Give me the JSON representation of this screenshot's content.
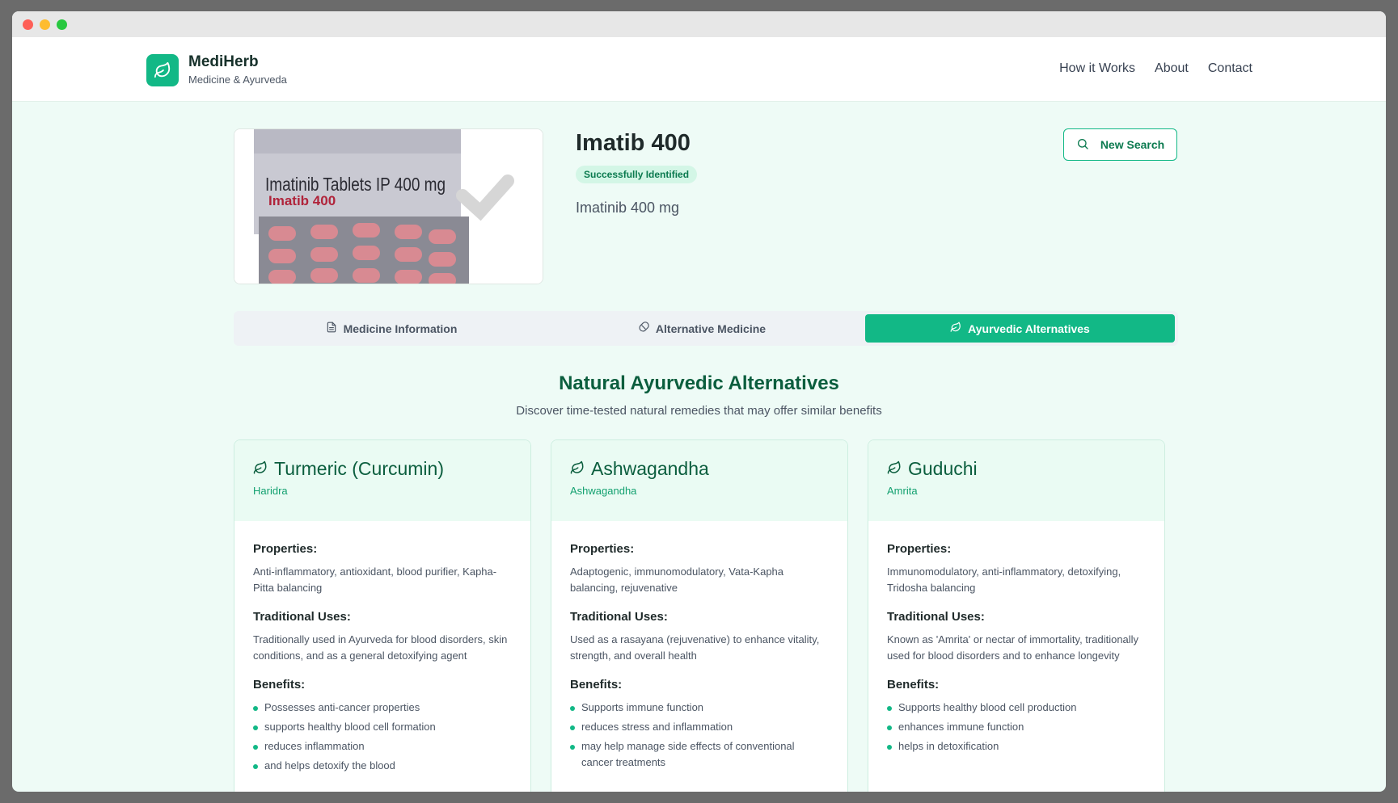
{
  "brand": {
    "name": "MediHerb",
    "tagline": "Medicine & Ayurveda"
  },
  "nav": [
    "How it Works",
    "About",
    "Contact"
  ],
  "medicine": {
    "name": "Imatib 400",
    "status": "Successfully Identified",
    "generic": "Imatinib 400 mg",
    "image": {
      "line1": "Imatinib Tablets IP 400 mg",
      "line2": "Imatib 400"
    }
  },
  "new_search_label": "New Search",
  "tabs": [
    {
      "label": "Medicine Information",
      "icon": "document-icon",
      "active": false
    },
    {
      "label": "Alternative Medicine",
      "icon": "pill-icon",
      "active": false
    },
    {
      "label": "Ayurvedic Alternatives",
      "icon": "leaf-icon",
      "active": true
    }
  ],
  "section": {
    "title": "Natural Ayurvedic Alternatives",
    "subtitle": "Discover time-tested natural remedies that may offer similar benefits"
  },
  "labels": {
    "properties": "Properties:",
    "uses": "Traditional Uses:",
    "benefits": "Benefits:"
  },
  "alternatives": [
    {
      "name": "Turmeric (Curcumin)",
      "sanskrit": "Haridra",
      "properties": "Anti-inflammatory, antioxidant, blood purifier, Kapha-Pitta balancing",
      "uses": "Traditionally used in Ayurveda for blood disorders, skin conditions, and as a general detoxifying agent",
      "benefits": [
        "Possesses anti-cancer properties",
        "supports healthy blood cell formation",
        "reduces inflammation",
        "and helps detoxify the blood"
      ]
    },
    {
      "name": "Ashwagandha",
      "sanskrit": "Ashwagandha",
      "properties": "Adaptogenic, immunomodulatory, Vata-Kapha balancing, rejuvenative",
      "uses": "Used as a rasayana (rejuvenative) to enhance vitality, strength, and overall health",
      "benefits": [
        "Supports immune function",
        "reduces stress and inflammation",
        "may help manage side effects of conventional cancer treatments"
      ]
    },
    {
      "name": "Guduchi",
      "sanskrit": "Amrita",
      "properties": "Immunomodulatory, anti-inflammatory, detoxifying, Tridosha balancing",
      "uses": "Known as 'Amrita' or nectar of immortality, traditionally used for blood disorders and to enhance longevity",
      "benefits": [
        "Supports healthy blood cell production",
        "enhances immune function",
        "helps in detoxification"
      ]
    }
  ],
  "colors": {
    "accent": "#12b886",
    "heading": "#0b5e3e",
    "background": "#eefbf6"
  }
}
